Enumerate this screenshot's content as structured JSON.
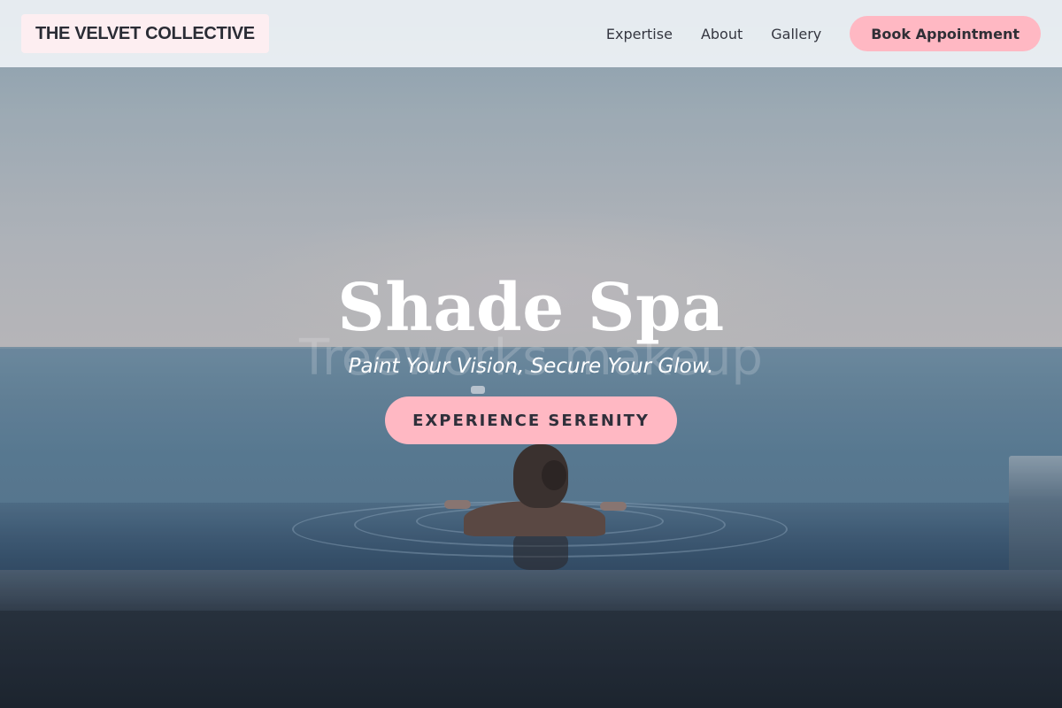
{
  "header": {
    "logo": "THE VELVET COLLECTIVE",
    "nav": [
      {
        "label": "Expertise"
      },
      {
        "label": "About"
      },
      {
        "label": "Gallery"
      }
    ],
    "cta_label": "Book Appointment"
  },
  "hero": {
    "title": "Shade Spa",
    "tagline": "Paint Your Vision, Secure Your Glow.",
    "button_label": "EXPERIENCE SERENITY",
    "ghost_text": "Treeworks makeup"
  },
  "colors": {
    "accent_pink": "#ffb8c3",
    "logo_bg": "#fdeef1",
    "header_bg": "#ecf0f4",
    "text_dark": "#2f2f36"
  },
  "icons": [
    "none"
  ]
}
